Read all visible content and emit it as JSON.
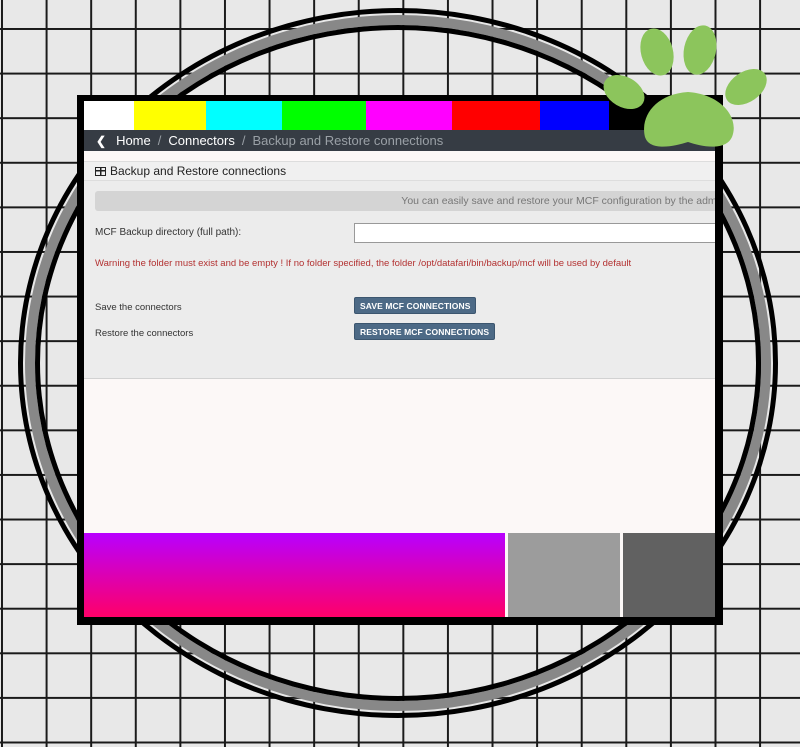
{
  "colors": {
    "bars": [
      "#ffffff",
      "#ffff00",
      "#00ffff",
      "#00ff00",
      "#ff00ff",
      "#ff0000",
      "#0000ff",
      "#000000"
    ],
    "paw": "#8cc55c"
  },
  "breadcrumb": {
    "back_icon": "chevron-left-icon",
    "home": "Home",
    "connectors": "Connectors",
    "current": "Backup and Restore connections"
  },
  "panel": {
    "icon": "table-icon",
    "title": "Backup and Restore connections",
    "info": "You can easily save and restore your MCF configuration by the admi",
    "directory_label": "MCF Backup directory (full path):",
    "directory_value": "",
    "warning": "Warning the folder must exist and be empty ! If no folder specified, the folder /opt/datafari/bin/backup/mcf will be used by default",
    "save_label": "Save the connectors",
    "save_button": "SAVE MCF CONNECTIONS",
    "restore_label": "Restore the connectors",
    "restore_button": "RESTORE MCF CONNECTIONS"
  }
}
